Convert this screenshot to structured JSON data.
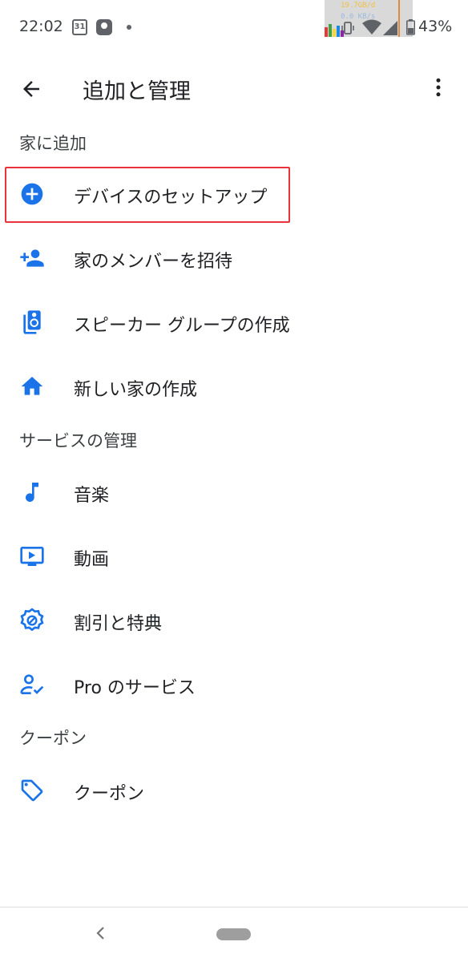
{
  "status_bar": {
    "time": "22:02",
    "calendar_day": "31",
    "net_speed_line1": "19.7GB/d",
    "net_speed_line2": "0.0 KB/s",
    "battery_percent": "43%"
  },
  "app_bar": {
    "title": "追加と管理",
    "back_icon": "arrow-back-icon",
    "more_icon": "more-vert-icon"
  },
  "sections": [
    {
      "header": "家に追加",
      "items": [
        {
          "label": "デバイスのセットアップ",
          "icon": "add-circle-icon",
          "highlighted": true
        },
        {
          "label": "家のメンバーを招待",
          "icon": "person-add-icon"
        },
        {
          "label": "スピーカー グループの作成",
          "icon": "speaker-icon"
        },
        {
          "label": "新しい家の作成",
          "icon": "home-icon"
        }
      ]
    },
    {
      "header": "サービスの管理",
      "items": [
        {
          "label": "音楽",
          "icon": "music-note-icon"
        },
        {
          "label": "動画",
          "icon": "video-play-icon"
        },
        {
          "label": "割引と特典",
          "icon": "discount-badge-icon"
        },
        {
          "label": "Pro のサービス",
          "icon": "pro-person-check-icon"
        }
      ]
    },
    {
      "header": "クーポン",
      "items": [
        {
          "label": "クーポン",
          "icon": "tag-icon"
        }
      ]
    }
  ],
  "colors": {
    "accent": "#1a73e8",
    "highlight_border": "#e8333a",
    "text_primary": "#202124",
    "text_secondary": "#3c4043"
  }
}
